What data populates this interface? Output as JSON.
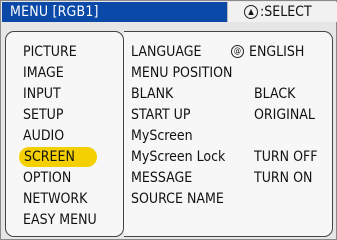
{
  "header": {
    "title": "MENU [RGB1]",
    "select_label": ":SELECT",
    "select_icon": "joystick-icon"
  },
  "colors": {
    "header_bg": "#0a49a8",
    "highlight": "#f4d000"
  },
  "left_menu": {
    "items": [
      {
        "label": "PICTURE"
      },
      {
        "label": "IMAGE"
      },
      {
        "label": "INPUT"
      },
      {
        "label": "SETUP"
      },
      {
        "label": "AUDIO"
      },
      {
        "label": "SCREEN"
      },
      {
        "label": "OPTION"
      },
      {
        "label": "NETWORK"
      },
      {
        "label": "EASY MENU"
      }
    ],
    "selected": "SCREEN"
  },
  "screen_menu": {
    "rows": [
      {
        "label": "LANGUAGE",
        "value": "ENGLISH",
        "icon": "globe-icon"
      },
      {
        "label": "MENU POSITION",
        "value": ""
      },
      {
        "label": "BLANK",
        "value": "BLACK"
      },
      {
        "label": "START UP",
        "value": "ORIGINAL"
      },
      {
        "label": "MyScreen",
        "value": ""
      },
      {
        "label": "MyScreen Lock",
        "value": "TURN OFF"
      },
      {
        "label": "MESSAGE",
        "value": "TURN ON"
      },
      {
        "label": "SOURCE NAME",
        "value": ""
      }
    ]
  }
}
